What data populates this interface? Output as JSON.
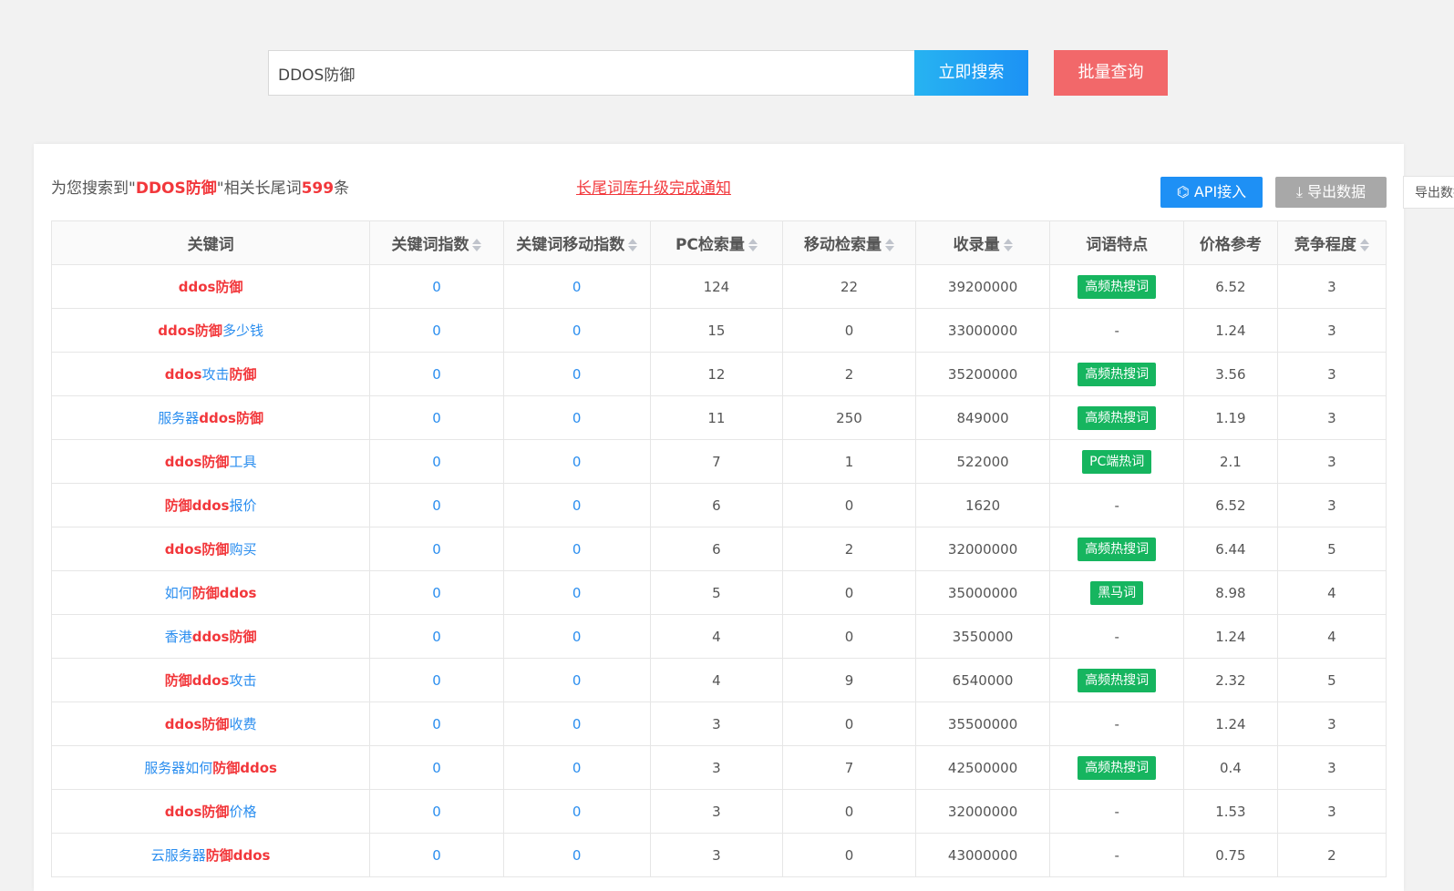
{
  "search": {
    "value": "DDOS防御",
    "button_label": "立即搜索",
    "batch_label": "批量查询"
  },
  "summary": {
    "prefix": "为您搜索到\"",
    "query": "DDOS防御",
    "middle": "\"相关长尾词",
    "count": "599",
    "suffix": "条"
  },
  "notice": "长尾词库升级完成通知",
  "toolbar": {
    "api_label": "API接入",
    "api_icon": "api-icon",
    "export_label": "导出数据",
    "export_icon": "download-icon",
    "tooltip": "导出数据"
  },
  "colors": {
    "accent": "#1e90f5",
    "danger": "#f2686a",
    "tag": "#16b55f",
    "highlight": "#f2373b"
  },
  "table": {
    "headers": [
      "关键词",
      "关键词指数",
      "关键词移动指数",
      "PC检索量",
      "移动检索量",
      "收录量",
      "词语特点",
      "价格参考",
      "竞争程度"
    ],
    "sortable": [
      false,
      true,
      true,
      true,
      true,
      true,
      false,
      false,
      true
    ],
    "rows": [
      {
        "kw": [
          [
            "ddos防御",
            true
          ]
        ],
        "idx": "0",
        "midx": "0",
        "pc": "124",
        "mob": "22",
        "inc": "39200000",
        "tag": "高频热搜词",
        "price": "6.52",
        "comp": "3"
      },
      {
        "kw": [
          [
            "ddos防御",
            true
          ],
          [
            "多少钱",
            false
          ]
        ],
        "idx": "0",
        "midx": "0",
        "pc": "15",
        "mob": "0",
        "inc": "33000000",
        "tag": "",
        "price": "1.24",
        "comp": "3"
      },
      {
        "kw": [
          [
            "ddos",
            true
          ],
          [
            "攻击",
            false
          ],
          [
            "防御",
            true
          ]
        ],
        "idx": "0",
        "midx": "0",
        "pc": "12",
        "mob": "2",
        "inc": "35200000",
        "tag": "高频热搜词",
        "price": "3.56",
        "comp": "3"
      },
      {
        "kw": [
          [
            "服务器",
            false
          ],
          [
            "ddos防御",
            true
          ]
        ],
        "idx": "0",
        "midx": "0",
        "pc": "11",
        "mob": "250",
        "inc": "849000",
        "tag": "高频热搜词",
        "price": "1.19",
        "comp": "3"
      },
      {
        "kw": [
          [
            "ddos防御",
            true
          ],
          [
            "工具",
            false
          ]
        ],
        "idx": "0",
        "midx": "0",
        "pc": "7",
        "mob": "1",
        "inc": "522000",
        "tag": "PC端热词",
        "price": "2.1",
        "comp": "3"
      },
      {
        "kw": [
          [
            "防御ddos",
            true
          ],
          [
            "报价",
            false
          ]
        ],
        "idx": "0",
        "midx": "0",
        "pc": "6",
        "mob": "0",
        "inc": "1620",
        "tag": "",
        "price": "6.52",
        "comp": "3"
      },
      {
        "kw": [
          [
            "ddos防御",
            true
          ],
          [
            "购买",
            false
          ]
        ],
        "idx": "0",
        "midx": "0",
        "pc": "6",
        "mob": "2",
        "inc": "32000000",
        "tag": "高频热搜词",
        "price": "6.44",
        "comp": "5"
      },
      {
        "kw": [
          [
            "如何",
            false
          ],
          [
            "防御ddos",
            true
          ]
        ],
        "idx": "0",
        "midx": "0",
        "pc": "5",
        "mob": "0",
        "inc": "35000000",
        "tag": "黑马词",
        "price": "8.98",
        "comp": "4"
      },
      {
        "kw": [
          [
            "香港",
            false
          ],
          [
            "ddos防御",
            true
          ]
        ],
        "idx": "0",
        "midx": "0",
        "pc": "4",
        "mob": "0",
        "inc": "3550000",
        "tag": "",
        "price": "1.24",
        "comp": "4"
      },
      {
        "kw": [
          [
            "防御ddos",
            true
          ],
          [
            "攻击",
            false
          ]
        ],
        "idx": "0",
        "midx": "0",
        "pc": "4",
        "mob": "9",
        "inc": "6540000",
        "tag": "高频热搜词",
        "price": "2.32",
        "comp": "5"
      },
      {
        "kw": [
          [
            "ddos防御",
            true
          ],
          [
            "收费",
            false
          ]
        ],
        "idx": "0",
        "midx": "0",
        "pc": "3",
        "mob": "0",
        "inc": "35500000",
        "tag": "",
        "price": "1.24",
        "comp": "3"
      },
      {
        "kw": [
          [
            "服务器如何",
            false
          ],
          [
            "防御ddos",
            true
          ]
        ],
        "idx": "0",
        "midx": "0",
        "pc": "3",
        "mob": "7",
        "inc": "42500000",
        "tag": "高频热搜词",
        "price": "0.4",
        "comp": "3"
      },
      {
        "kw": [
          [
            "ddos防御",
            true
          ],
          [
            "价格",
            false
          ]
        ],
        "idx": "0",
        "midx": "0",
        "pc": "3",
        "mob": "0",
        "inc": "32000000",
        "tag": "",
        "price": "1.53",
        "comp": "3"
      },
      {
        "kw": [
          [
            "云服务器",
            false
          ],
          [
            "防御ddos",
            true
          ]
        ],
        "idx": "0",
        "midx": "0",
        "pc": "3",
        "mob": "0",
        "inc": "43000000",
        "tag": "",
        "price": "0.75",
        "comp": "2"
      }
    ],
    "empty_tag": "-"
  }
}
